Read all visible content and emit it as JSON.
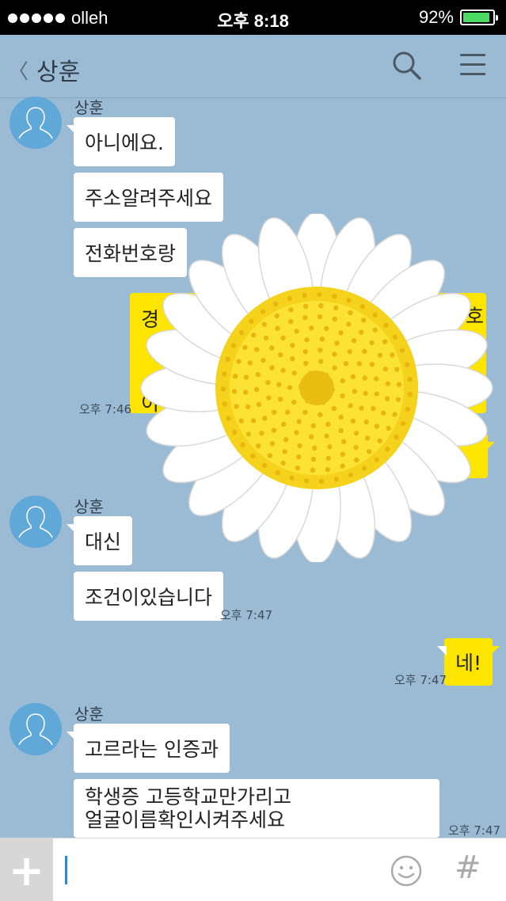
{
  "status_bar": {
    "carrier": "olleh",
    "time": "오후 8:18",
    "battery": "92%",
    "battery_level": 0.92
  },
  "header": {
    "back_label": "〈",
    "title": "상훈",
    "search_icon": "search-icon",
    "menu_icon": "menu-icon"
  },
  "messages": [
    {
      "sender": "상훈",
      "text": "아니에요."
    },
    {
      "text": "주소알려주세요"
    },
    {
      "text": "전화번호랑"
    },
    {
      "mine_partial_1": "경",
      "mine_partial_2": "이",
      "mine_partial_3": "호",
      "time": "오후 7:46"
    },
    {
      "sender": "상훈",
      "text": "대신"
    },
    {
      "text": "조건이있습니다",
      "time": "오후 7:47"
    },
    {
      "mine_text": "네!",
      "time": "오후 7:47"
    },
    {
      "sender": "상훈",
      "text": "고르라는 인증과"
    },
    {
      "text_line1": "학생증 고등학교만가리고",
      "text_line2": "얼굴이름확인시켜주세요",
      "time": "오후 7:47"
    }
  ],
  "input_bar": {
    "plus_label": "+",
    "hash_label": "#",
    "emoji_icon": "smiley-icon"
  }
}
